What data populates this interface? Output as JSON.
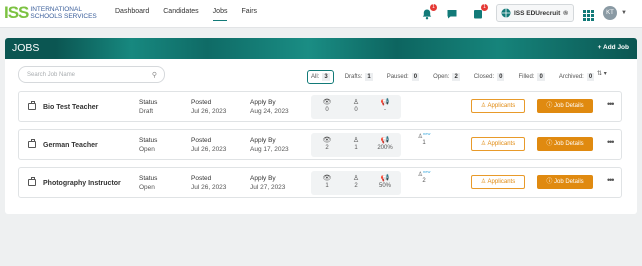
{
  "logo": {
    "mark": "ISS",
    "line1": "INTERNATIONAL",
    "line2": "SCHOOLS SERVICES"
  },
  "nav": [
    "Dashboard",
    "Candidates",
    "Jobs",
    "Fairs"
  ],
  "header": {
    "notifications_count": "1",
    "cart_count": "1",
    "brand_label": "ISS EDUrecruit",
    "brand_mark": "®",
    "avatar_initials": "KT"
  },
  "page": {
    "title": "JOBS",
    "add_label": "+ Add Job"
  },
  "search": {
    "placeholder": "Search Job Name"
  },
  "filters": [
    {
      "label": "All:",
      "count": "3"
    },
    {
      "label": "Drafts:",
      "count": "1"
    },
    {
      "label": "Paused:",
      "count": "0"
    },
    {
      "label": "Open:",
      "count": "2"
    },
    {
      "label": "Closed:",
      "count": "0"
    },
    {
      "label": "Filled:",
      "count": "0"
    },
    {
      "label": "Archived:",
      "count": "0"
    }
  ],
  "labels": {
    "status": "Status",
    "posted": "Posted",
    "apply_by": "Apply By",
    "applicants": "Applicants",
    "job_details": "Job Details",
    "new_tag": "new"
  },
  "jobs": [
    {
      "title": "Bio Test Teacher",
      "status": "Draft",
      "posted": "Jul 26, 2023",
      "apply_by": "Aug 24, 2023",
      "views": "0",
      "applicants": "0",
      "promo": "-",
      "new_count": ""
    },
    {
      "title": "German Teacher",
      "status": "Open",
      "posted": "Jul 26, 2023",
      "apply_by": "Aug 17, 2023",
      "views": "2",
      "applicants": "1",
      "promo": "200%",
      "new_count": "1"
    },
    {
      "title": "Photography Instructor",
      "status": "Open",
      "posted": "Jul 26, 2023",
      "apply_by": "Jul 27, 2023",
      "views": "1",
      "applicants": "2",
      "promo": "50%",
      "new_count": "2"
    }
  ],
  "colors": {
    "accent": "#127a78",
    "orange": "#e08a10",
    "badge": "#e53935"
  }
}
